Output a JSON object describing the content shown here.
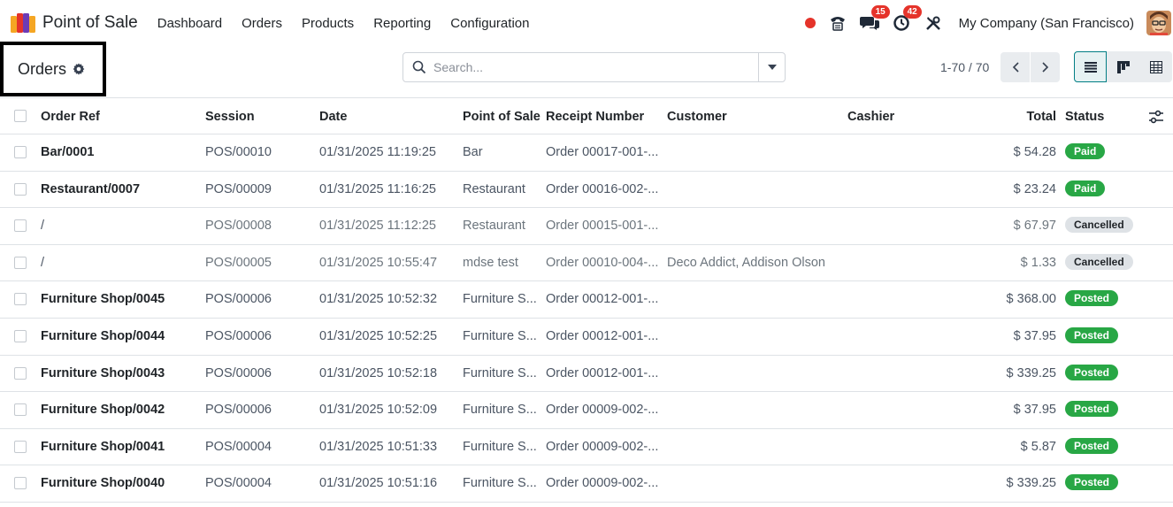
{
  "app": {
    "title": "Point of Sale"
  },
  "nav": {
    "items": [
      "Dashboard",
      "Orders",
      "Products",
      "Reporting",
      "Configuration"
    ]
  },
  "systray": {
    "messages_count": "15",
    "activities_count": "42",
    "company": "My Company (San Francisco)"
  },
  "control": {
    "title": "Orders",
    "search_placeholder": "Search...",
    "pager": "1-70 / 70"
  },
  "table": {
    "headers": {
      "ref": "Order Ref",
      "session": "Session",
      "date": "Date",
      "pos": "Point of Sale",
      "receipt": "Receipt Number",
      "customer": "Customer",
      "cashier": "Cashier",
      "total": "Total",
      "status": "Status"
    },
    "rows": [
      {
        "ref": "Bar/0001",
        "session": "POS/00010",
        "date": "01/31/2025 11:19:25",
        "pos": "Bar",
        "receipt": "Order 00017-001-...",
        "customer": "",
        "cashier": "",
        "total": "$ 54.28",
        "status": "Paid"
      },
      {
        "ref": "Restaurant/0007",
        "session": "POS/00009",
        "date": "01/31/2025 11:16:25",
        "pos": "Restaurant",
        "receipt": "Order 00016-002-...",
        "customer": "",
        "cashier": "",
        "total": "$ 23.24",
        "status": "Paid"
      },
      {
        "ref": "/",
        "session": "POS/00008",
        "date": "01/31/2025 11:12:25",
        "pos": "Restaurant",
        "receipt": "Order 00015-001-...",
        "customer": "",
        "cashier": "",
        "total": "$ 67.97",
        "status": "Cancelled"
      },
      {
        "ref": "/",
        "session": "POS/00005",
        "date": "01/31/2025 10:55:47",
        "pos": "mdse test",
        "receipt": "Order 00010-004-...",
        "customer": "Deco Addict, Addison Olson",
        "cashier": "",
        "total": "$ 1.33",
        "status": "Cancelled"
      },
      {
        "ref": "Furniture Shop/0045",
        "session": "POS/00006",
        "date": "01/31/2025 10:52:32",
        "pos": "Furniture S...",
        "receipt": "Order 00012-001-...",
        "customer": "",
        "cashier": "",
        "total": "$ 368.00",
        "status": "Posted"
      },
      {
        "ref": "Furniture Shop/0044",
        "session": "POS/00006",
        "date": "01/31/2025 10:52:25",
        "pos": "Furniture S...",
        "receipt": "Order 00012-001-...",
        "customer": "",
        "cashier": "",
        "total": "$ 37.95",
        "status": "Posted"
      },
      {
        "ref": "Furniture Shop/0043",
        "session": "POS/00006",
        "date": "01/31/2025 10:52:18",
        "pos": "Furniture S...",
        "receipt": "Order 00012-001-...",
        "customer": "",
        "cashier": "",
        "total": "$ 339.25",
        "status": "Posted"
      },
      {
        "ref": "Furniture Shop/0042",
        "session": "POS/00006",
        "date": "01/31/2025 10:52:09",
        "pos": "Furniture S...",
        "receipt": "Order 00009-002-...",
        "customer": "",
        "cashier": "",
        "total": "$ 37.95",
        "status": "Posted"
      },
      {
        "ref": "Furniture Shop/0041",
        "session": "POS/00004",
        "date": "01/31/2025 10:51:33",
        "pos": "Furniture S...",
        "receipt": "Order 00009-002-...",
        "customer": "",
        "cashier": "",
        "total": "$ 5.87",
        "status": "Posted"
      },
      {
        "ref": "Furniture Shop/0040",
        "session": "POS/00004",
        "date": "01/31/2025 10:51:16",
        "pos": "Furniture S...",
        "receipt": "Order 00009-002-...",
        "customer": "",
        "cashier": "",
        "total": "$ 339.25",
        "status": "Posted"
      }
    ]
  },
  "colors": {
    "accent": "#017e84",
    "badge_red": "#e5332a",
    "status_green": "#28a745",
    "status_grey": "#dee2e6"
  }
}
